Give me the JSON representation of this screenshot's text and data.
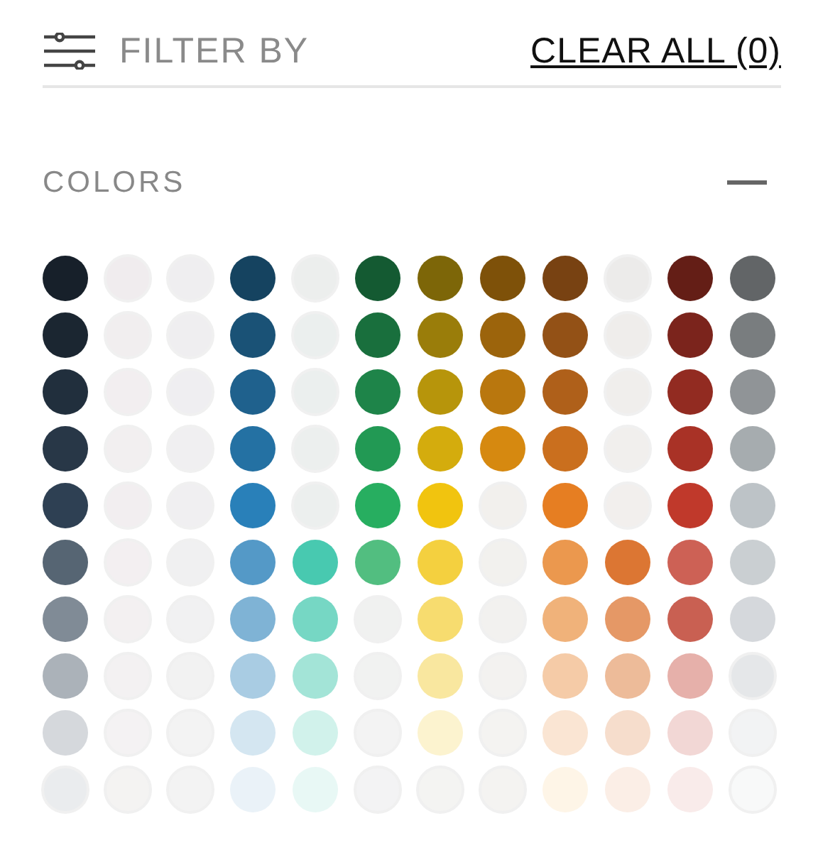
{
  "header": {
    "title": "FILTER BY",
    "clear_link": "CLEAR ALL (0)"
  },
  "section": {
    "title": "COLORS",
    "expanded": true,
    "swatches": [
      {
        "color": "#17202a"
      },
      {
        "color": "#f0ecee"
      },
      {
        "color": "#efeef0"
      },
      {
        "color": "#154360"
      },
      {
        "color": "#eceeed"
      },
      {
        "color": "#145a32"
      },
      {
        "color": "#7d6608"
      },
      {
        "color": "#7e5109"
      },
      {
        "color": "#784212"
      },
      {
        "color": "#ecebea"
      },
      {
        "color": "#641e16"
      },
      {
        "color": "#626567"
      },
      {
        "color": "#1b2631"
      },
      {
        "color": "#f1eeef"
      },
      {
        "color": "#efeef0"
      },
      {
        "color": "#1a5276"
      },
      {
        "color": "#ebefee"
      },
      {
        "color": "#196f3d"
      },
      {
        "color": "#9a7d0a"
      },
      {
        "color": "#9c640c"
      },
      {
        "color": "#935116"
      },
      {
        "color": "#efedeb"
      },
      {
        "color": "#7b241c"
      },
      {
        "color": "#797d7f"
      },
      {
        "color": "#212f3d"
      },
      {
        "color": "#f2eef0"
      },
      {
        "color": "#efeef1"
      },
      {
        "color": "#1f618d"
      },
      {
        "color": "#ebefee"
      },
      {
        "color": "#1e8449"
      },
      {
        "color": "#b7950b"
      },
      {
        "color": "#b9770e"
      },
      {
        "color": "#af601a"
      },
      {
        "color": "#f0eeec"
      },
      {
        "color": "#922b21"
      },
      {
        "color": "#909497"
      },
      {
        "color": "#283747"
      },
      {
        "color": "#f2eff0"
      },
      {
        "color": "#f0eff1"
      },
      {
        "color": "#2471a3"
      },
      {
        "color": "#ecefee"
      },
      {
        "color": "#229954"
      },
      {
        "color": "#d4ac0d"
      },
      {
        "color": "#d68910"
      },
      {
        "color": "#ca6f1e"
      },
      {
        "color": "#f1efed"
      },
      {
        "color": "#a93226"
      },
      {
        "color": "#a6acaf"
      },
      {
        "color": "#2e4053"
      },
      {
        "color": "#f2eef0"
      },
      {
        "color": "#f0eff1"
      },
      {
        "color": "#2980b9"
      },
      {
        "color": "#ecefee"
      },
      {
        "color": "#27ae60"
      },
      {
        "color": "#f1c40f"
      },
      {
        "color": "#f2f0ed"
      },
      {
        "color": "#e67e22"
      },
      {
        "color": "#f2efed"
      },
      {
        "color": "#c0392b"
      },
      {
        "color": "#bdc3c7"
      },
      {
        "color": "#566573"
      },
      {
        "color": "#f3eff1"
      },
      {
        "color": "#f0f0f1"
      },
      {
        "color": "#5499c7"
      },
      {
        "color": "#48c9b0"
      },
      {
        "color": "#52be80"
      },
      {
        "color": "#f4d03f"
      },
      {
        "color": "#f2f1ee"
      },
      {
        "color": "#eb984e"
      },
      {
        "color": "#dc7633"
      },
      {
        "color": "#cd6155"
      },
      {
        "color": "#cacfd2"
      },
      {
        "color": "#808b96"
      },
      {
        "color": "#f3f0f1"
      },
      {
        "color": "#f1f1f2"
      },
      {
        "color": "#7fb3d5"
      },
      {
        "color": "#76d7c4"
      },
      {
        "color": "#f0f1f0"
      },
      {
        "color": "#f7dc6f"
      },
      {
        "color": "#f2f1ef"
      },
      {
        "color": "#f0b27a"
      },
      {
        "color": "#e59866"
      },
      {
        "color": "#c96052"
      },
      {
        "color": "#d5d8dc"
      },
      {
        "color": "#abb2b9"
      },
      {
        "color": "#f3f1f2"
      },
      {
        "color": "#f2f2f2"
      },
      {
        "color": "#a9cce3"
      },
      {
        "color": "#a3e4d7"
      },
      {
        "color": "#f1f2f1"
      },
      {
        "color": "#f9e79f"
      },
      {
        "color": "#f3f2f0"
      },
      {
        "color": "#f5cba7"
      },
      {
        "color": "#edbb99"
      },
      {
        "color": "#e6b0aa"
      },
      {
        "color": "#e5e7e9"
      },
      {
        "color": "#d5d8dc"
      },
      {
        "color": "#f4f2f3"
      },
      {
        "color": "#f3f3f3"
      },
      {
        "color": "#d4e6f1"
      },
      {
        "color": "#d1f2eb"
      },
      {
        "color": "#f3f3f3"
      },
      {
        "color": "#fcf3cf"
      },
      {
        "color": "#f4f3f1"
      },
      {
        "color": "#fae5d3"
      },
      {
        "color": "#f6ddcc"
      },
      {
        "color": "#f2d7d5"
      },
      {
        "color": "#f2f3f4"
      },
      {
        "color": "#eaecee"
      },
      {
        "color": "#f4f3f2"
      },
      {
        "color": "#f3f3f3"
      },
      {
        "color": "#eaf2f8"
      },
      {
        "color": "#e8f8f5"
      },
      {
        "color": "#f3f3f4"
      },
      {
        "color": "#f4f4f2"
      },
      {
        "color": "#f4f3f1"
      },
      {
        "color": "#fef5e7"
      },
      {
        "color": "#fbeee6"
      },
      {
        "color": "#f9ebea"
      },
      {
        "color": "#f8f9f9"
      }
    ]
  }
}
